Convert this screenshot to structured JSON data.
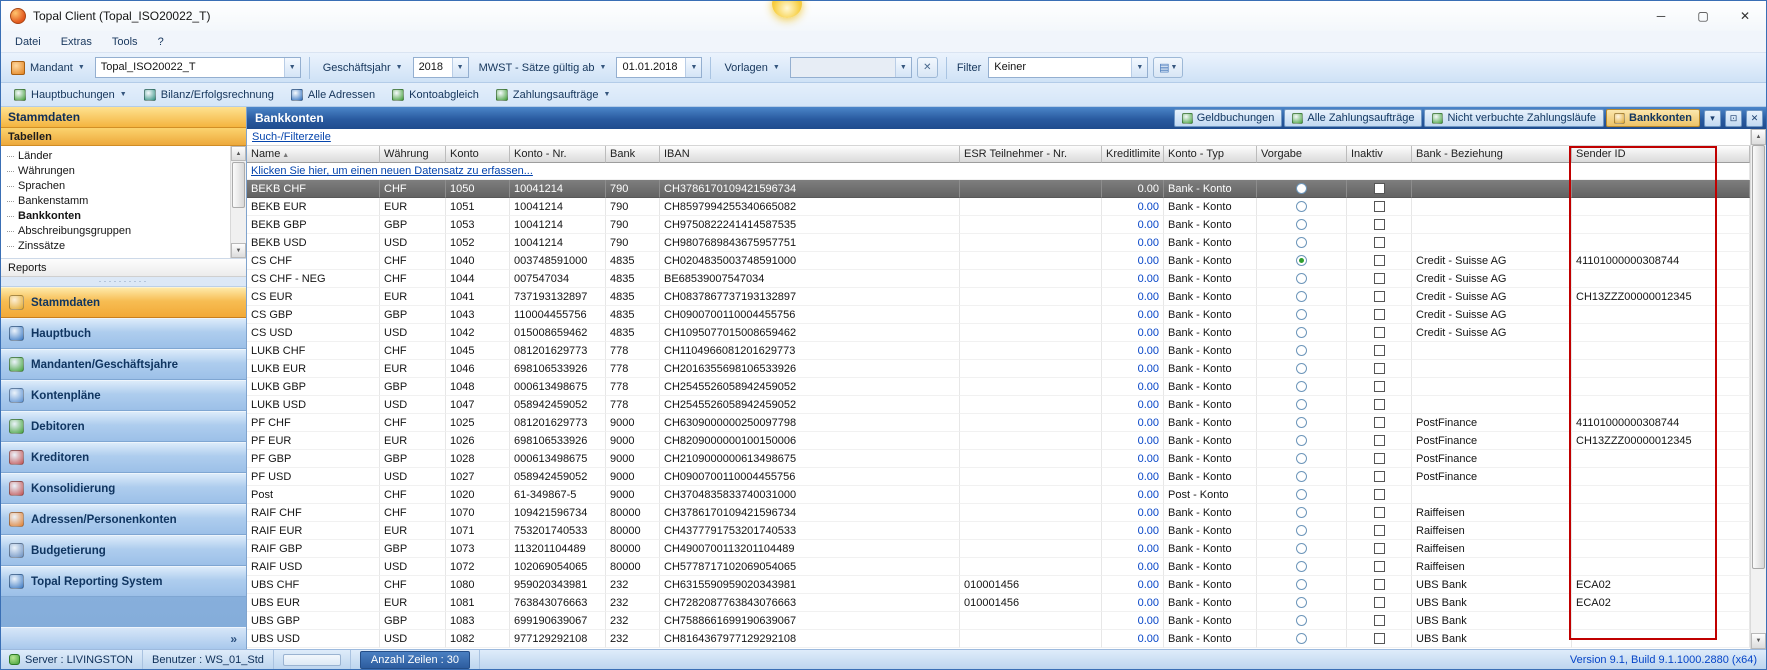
{
  "window": {
    "title": "Topal Client (Topal_ISO20022_T)"
  },
  "menubar": {
    "items": [
      "Datei",
      "Extras",
      "Tools",
      "?"
    ]
  },
  "toolbar": {
    "mandant": {
      "label": "Mandant",
      "value": "Topal_ISO20022_T"
    },
    "geschaeftsjahr": {
      "label": "Geschäftsjahr",
      "value": "2018"
    },
    "mwst": {
      "label": "MWST - Sätze gültig ab",
      "value": "01.01.2018"
    },
    "vorlagen": {
      "label": "Vorlagen",
      "value": ""
    },
    "filter": {
      "label": "Filter",
      "value": "Keiner"
    }
  },
  "quickbar": {
    "items": [
      {
        "label": "Hauptbuchungen",
        "icon": "journal-icon",
        "color": "#3f9c35",
        "dropdown": true
      },
      {
        "label": "Bilanz/Erfolgsrechnung",
        "icon": "balance-icon",
        "color": "#2f8f80",
        "dropdown": false
      },
      {
        "label": "Alle Adressen",
        "icon": "addresses-icon",
        "color": "#2f6fbd",
        "dropdown": false
      },
      {
        "label": "Kontoabgleich",
        "icon": "reconcile-icon",
        "color": "#3f9c35",
        "dropdown": false
      },
      {
        "label": "Zahlungsaufträge",
        "icon": "payments-icon",
        "color": "#3f9c35",
        "dropdown": true
      }
    ]
  },
  "sidebar": {
    "header": "Stammdaten",
    "section_header": "Tabellen",
    "tree": [
      {
        "label": "Länder",
        "selected": false
      },
      {
        "label": "Währungen",
        "selected": false
      },
      {
        "label": "Sprachen",
        "selected": false
      },
      {
        "label": "Bankenstamm",
        "selected": false
      },
      {
        "label": "Bankkonten",
        "selected": true
      },
      {
        "label": "Abschreibungsgruppen",
        "selected": false
      },
      {
        "label": "Zinssätze",
        "selected": false
      }
    ],
    "reports_label": "Reports",
    "collapse_chevron": "»",
    "nav": [
      {
        "label": "Stammdaten",
        "icon": "master-data-icon",
        "color": "#e0a82e",
        "active": true
      },
      {
        "label": "Hauptbuch",
        "icon": "ledger-icon",
        "color": "#3a78c2",
        "active": false
      },
      {
        "label": "Mandanten/Geschäftsjahre",
        "icon": "clients-icon",
        "color": "#43a13a",
        "active": false
      },
      {
        "label": "Kontenpläne",
        "icon": "chart-of-accounts-icon",
        "color": "#5a8fd0",
        "active": false
      },
      {
        "label": "Debitoren",
        "icon": "debtors-icon",
        "color": "#43a13a",
        "active": false
      },
      {
        "label": "Kreditoren",
        "icon": "creditors-icon",
        "color": "#c05050",
        "active": false
      },
      {
        "label": "Konsolidierung",
        "icon": "consolidation-icon",
        "color": "#c05050",
        "active": false
      },
      {
        "label": "Adressen/Personenkonten",
        "icon": "persons-icon",
        "color": "#e07f2f",
        "active": false
      },
      {
        "label": "Budgetierung",
        "icon": "budgeting-icon",
        "color": "#6a8fc0",
        "active": false
      },
      {
        "label": "Topal Reporting System",
        "icon": "reporting-icon",
        "color": "#3a78c2",
        "active": false
      }
    ]
  },
  "main": {
    "panel_title": "Bankkonten",
    "tabs": [
      {
        "label": "Geldbuchungen",
        "icon": "money-bookings-icon",
        "color": "#43a13a",
        "active": false
      },
      {
        "label": "Alle Zahlungsaufträge",
        "icon": "payment-orders-icon",
        "color": "#43a13a",
        "active": false
      },
      {
        "label": "Nicht verbuchte Zahlungsläufe",
        "icon": "payment-runs-icon",
        "color": "#43a13a",
        "active": false
      },
      {
        "label": "Bankkonten",
        "icon": "bank-accounts-icon",
        "color": "#e0a82e",
        "active": true
      }
    ],
    "filter_row_label": "Such-/Filterzeile",
    "new_record_label": "Klicken Sie hier, um einen neuen Datensatz zu erfassen...",
    "highlight_color": "#c00000",
    "table": {
      "columns": [
        {
          "label": "Name",
          "sort": "asc"
        },
        {
          "label": "Währung"
        },
        {
          "label": "Konto"
        },
        {
          "label": "Konto - Nr."
        },
        {
          "label": "Bank"
        },
        {
          "label": "IBAN"
        },
        {
          "label": "ESR Teilnehmer - Nr."
        },
        {
          "label": "Kreditlimite",
          "align": "right"
        },
        {
          "label": "Konto - Typ"
        },
        {
          "label": "Vorgabe"
        },
        {
          "label": "Inaktiv"
        },
        {
          "label": "Bank - Beziehung"
        },
        {
          "label": "Sender ID"
        }
      ],
      "rows": [
        {
          "name": "BEKB CHF",
          "currency": "CHF",
          "account": "1050",
          "account_no": "10041214",
          "bank": "790",
          "iban": "CH3786170109421596734",
          "esr": "",
          "credit_limit": "0.00",
          "account_type": "Bank - Konto",
          "is_default": false,
          "relation": "",
          "sender_id": "",
          "selected": true
        },
        {
          "name": "BEKB EUR",
          "currency": "EUR",
          "account": "1051",
          "account_no": "10041214",
          "bank": "790",
          "iban": "CH8597994255340665082",
          "esr": "",
          "credit_limit": "0.00",
          "account_type": "Bank - Konto",
          "is_default": false,
          "relation": "",
          "sender_id": ""
        },
        {
          "name": "BEKB GBP",
          "currency": "GBP",
          "account": "1053",
          "account_no": "10041214",
          "bank": "790",
          "iban": "CH9750822241414587535",
          "esr": "",
          "credit_limit": "0.00",
          "account_type": "Bank - Konto",
          "is_default": false,
          "relation": "",
          "sender_id": ""
        },
        {
          "name": "BEKB USD",
          "currency": "USD",
          "account": "1052",
          "account_no": "10041214",
          "bank": "790",
          "iban": "CH9807689843675957751",
          "esr": "",
          "credit_limit": "0.00",
          "account_type": "Bank - Konto",
          "is_default": false,
          "relation": "",
          "sender_id": ""
        },
        {
          "name": "CS CHF",
          "currency": "CHF",
          "account": "1040",
          "account_no": "003748591000",
          "bank": "4835",
          "iban": "CH0204835003748591000",
          "esr": "",
          "credit_limit": "0.00",
          "account_type": "Bank - Konto",
          "is_default": true,
          "relation": "Credit - Suisse AG",
          "sender_id": "41101000000308744"
        },
        {
          "name": "CS CHF - NEG",
          "currency": "CHF",
          "account": "1044",
          "account_no": "007547034",
          "bank": "4835",
          "iban": "BE68539007547034",
          "esr": "",
          "credit_limit": "0.00",
          "account_type": "Bank - Konto",
          "is_default": false,
          "relation": "Credit - Suisse AG",
          "sender_id": ""
        },
        {
          "name": "CS EUR",
          "currency": "EUR",
          "account": "1041",
          "account_no": "737193132897",
          "bank": "4835",
          "iban": "CH0837867737193132897",
          "esr": "",
          "credit_limit": "0.00",
          "account_type": "Bank - Konto",
          "is_default": false,
          "relation": "Credit - Suisse AG",
          "sender_id": "CH13ZZZ00000012345"
        },
        {
          "name": "CS GBP",
          "currency": "GBP",
          "account": "1043",
          "account_no": "110004455756",
          "bank": "4835",
          "iban": "CH0900700110004455756",
          "esr": "",
          "credit_limit": "0.00",
          "account_type": "Bank - Konto",
          "is_default": false,
          "relation": "Credit - Suisse AG",
          "sender_id": ""
        },
        {
          "name": "CS USD",
          "currency": "USD",
          "account": "1042",
          "account_no": "015008659462",
          "bank": "4835",
          "iban": "CH1095077015008659462",
          "esr": "",
          "credit_limit": "0.00",
          "account_type": "Bank - Konto",
          "is_default": false,
          "relation": "Credit - Suisse AG",
          "sender_id": ""
        },
        {
          "name": "LUKB CHF",
          "currency": "CHF",
          "account": "1045",
          "account_no": "081201629773",
          "bank": "778",
          "iban": "CH1104966081201629773",
          "esr": "",
          "credit_limit": "0.00",
          "account_type": "Bank - Konto",
          "is_default": false,
          "relation": "",
          "sender_id": ""
        },
        {
          "name": "LUKB EUR",
          "currency": "EUR",
          "account": "1046",
          "account_no": "698106533926",
          "bank": "778",
          "iban": "CH2016355698106533926",
          "esr": "",
          "credit_limit": "0.00",
          "account_type": "Bank - Konto",
          "is_default": false,
          "relation": "",
          "sender_id": ""
        },
        {
          "name": "LUKB GBP",
          "currency": "GBP",
          "account": "1048",
          "account_no": "000613498675",
          "bank": "778",
          "iban": "CH2545526058942459052",
          "esr": "",
          "credit_limit": "0.00",
          "account_type": "Bank - Konto",
          "is_default": false,
          "relation": "",
          "sender_id": ""
        },
        {
          "name": "LUKB USD",
          "currency": "USD",
          "account": "1047",
          "account_no": "058942459052",
          "bank": "778",
          "iban": "CH2545526058942459052",
          "esr": "",
          "credit_limit": "0.00",
          "account_type": "Bank - Konto",
          "is_default": false,
          "relation": "",
          "sender_id": ""
        },
        {
          "name": "PF CHF",
          "currency": "CHF",
          "account": "1025",
          "account_no": "081201629773",
          "bank": "9000",
          "iban": "CH6309000000250097798",
          "esr": "",
          "credit_limit": "0.00",
          "account_type": "Bank - Konto",
          "is_default": false,
          "relation": "PostFinance",
          "sender_id": "41101000000308744"
        },
        {
          "name": "PF EUR",
          "currency": "EUR",
          "account": "1026",
          "account_no": "698106533926",
          "bank": "9000",
          "iban": "CH8209000000100150006",
          "esr": "",
          "credit_limit": "0.00",
          "account_type": "Bank - Konto",
          "is_default": false,
          "relation": "PostFinance",
          "sender_id": "CH13ZZZ00000012345"
        },
        {
          "name": "PF GBP",
          "currency": "GBP",
          "account": "1028",
          "account_no": "000613498675",
          "bank": "9000",
          "iban": "CH2109000000613498675",
          "esr": "",
          "credit_limit": "0.00",
          "account_type": "Bank - Konto",
          "is_default": false,
          "relation": "PostFinance",
          "sender_id": ""
        },
        {
          "name": "PF USD",
          "currency": "USD",
          "account": "1027",
          "account_no": "058942459052",
          "bank": "9000",
          "iban": "CH0900700110004455756",
          "esr": "",
          "credit_limit": "0.00",
          "account_type": "Bank - Konto",
          "is_default": false,
          "relation": "PostFinance",
          "sender_id": ""
        },
        {
          "name": "Post",
          "currency": "CHF",
          "account": "1020",
          "account_no": "61-349867-5",
          "bank": "9000",
          "iban": "CH3704835833740031000",
          "esr": "",
          "credit_limit": "0.00",
          "account_type": "Post - Konto",
          "is_default": false,
          "relation": "",
          "sender_id": ""
        },
        {
          "name": "RAIF CHF",
          "currency": "CHF",
          "account": "1070",
          "account_no": "109421596734",
          "bank": "80000",
          "iban": "CH3786170109421596734",
          "esr": "",
          "credit_limit": "0.00",
          "account_type": "Bank - Konto",
          "is_default": false,
          "relation": "Raiffeisen",
          "sender_id": ""
        },
        {
          "name": "RAIF EUR",
          "currency": "EUR",
          "account": "1071",
          "account_no": "753201740533",
          "bank": "80000",
          "iban": "CH4377791753201740533",
          "esr": "",
          "credit_limit": "0.00",
          "account_type": "Bank - Konto",
          "is_default": false,
          "relation": "Raiffeisen",
          "sender_id": ""
        },
        {
          "name": "RAIF GBP",
          "currency": "GBP",
          "account": "1073",
          "account_no": "113201104489",
          "bank": "80000",
          "iban": "CH4900700113201104489",
          "esr": "",
          "credit_limit": "0.00",
          "account_type": "Bank - Konto",
          "is_default": false,
          "relation": "Raiffeisen",
          "sender_id": ""
        },
        {
          "name": "RAIF USD",
          "currency": "USD",
          "account": "1072",
          "account_no": "102069054065",
          "bank": "80000",
          "iban": "CH5778717102069054065",
          "esr": "",
          "credit_limit": "0.00",
          "account_type": "Bank - Konto",
          "is_default": false,
          "relation": "Raiffeisen",
          "sender_id": ""
        },
        {
          "name": "UBS CHF",
          "currency": "CHF",
          "account": "1080",
          "account_no": "959020343981",
          "bank": "232",
          "iban": "CH6315590959020343981",
          "esr": "010001456",
          "credit_limit": "0.00",
          "account_type": "Bank - Konto",
          "is_default": false,
          "relation": "UBS Bank",
          "sender_id": "ECA02"
        },
        {
          "name": "UBS EUR",
          "currency": "EUR",
          "account": "1081",
          "account_no": "763843076663",
          "bank": "232",
          "iban": "CH7282087763843076663",
          "esr": "010001456",
          "credit_limit": "0.00",
          "account_type": "Bank - Konto",
          "is_default": false,
          "relation": "UBS Bank",
          "sender_id": "ECA02"
        },
        {
          "name": "UBS GBP",
          "currency": "GBP",
          "account": "1083",
          "account_no": "699190639067",
          "bank": "232",
          "iban": "CH7588661699190639067",
          "esr": "",
          "credit_limit": "0.00",
          "account_type": "Bank - Konto",
          "is_default": false,
          "relation": "UBS Bank",
          "sender_id": ""
        },
        {
          "name": "UBS USD",
          "currency": "USD",
          "account": "1082",
          "account_no": "977129292108",
          "bank": "232",
          "iban": "CH8164367977129292108",
          "esr": "",
          "credit_limit": "0.00",
          "account_type": "Bank - Konto",
          "is_default": false,
          "relation": "UBS Bank",
          "sender_id": ""
        }
      ]
    }
  },
  "statusbar": {
    "server": "Server : LIVINGSTON",
    "user": "Benutzer : WS_01_Std",
    "row_count": "Anzahl Zeilen : 30",
    "version": "Version 9.1, Build 9.1.1000.2880 (x64)"
  }
}
